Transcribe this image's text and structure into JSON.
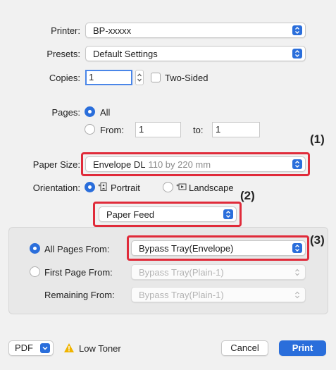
{
  "printer": {
    "label": "Printer:",
    "value": "BP-xxxxx"
  },
  "presets": {
    "label": "Presets:",
    "value": "Default Settings"
  },
  "copies": {
    "label": "Copies:",
    "value": "1",
    "two_sided_label": "Two-Sided"
  },
  "pages": {
    "label": "Pages:",
    "all_label": "All",
    "from_label": "From:",
    "from_value": "1",
    "to_label": "to:",
    "to_value": "1"
  },
  "paper_size": {
    "label": "Paper Size:",
    "value": "Envelope DL",
    "detail": "110 by 220 mm"
  },
  "orientation": {
    "label": "Orientation:",
    "portrait_label": "Portrait",
    "landscape_label": "Landscape"
  },
  "section_popup": {
    "value": "Paper Feed"
  },
  "paper_feed": {
    "all_pages_label": "All Pages From:",
    "all_pages_value": "Bypass Tray(Envelope)",
    "first_page_label": "First Page From:",
    "first_page_value": "Bypass Tray(Plain-1)",
    "remaining_label": "Remaining From:",
    "remaining_value": "Bypass Tray(Plain-1)"
  },
  "footer": {
    "pdf_label": "PDF",
    "warning_text": "Low Toner",
    "cancel_label": "Cancel",
    "print_label": "Print"
  },
  "callouts": {
    "c1": "(1)",
    "c2": "(2)",
    "c3": "(3)"
  },
  "colors": {
    "accent": "#2a6edb",
    "highlight": "#e02b3a",
    "warning": "#f0b400"
  }
}
